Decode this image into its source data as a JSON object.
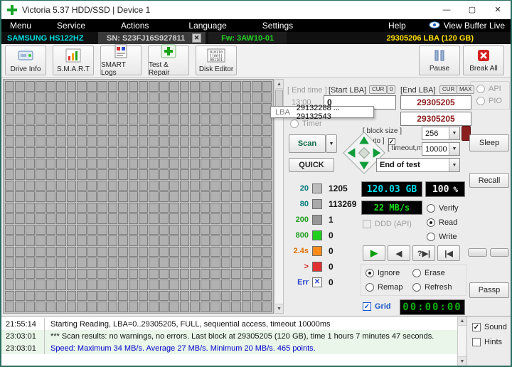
{
  "window": {
    "title": "Victoria 5.37 HDD/SSD | Device 1",
    "minimize_icon": "—",
    "maximize_icon": "▢",
    "close_icon": "✕"
  },
  "icons": {
    "dropdown": "▼",
    "arrow_up": "▲",
    "arrow_down": "▼"
  },
  "menu": {
    "items": [
      "Menu",
      "Service",
      "Actions",
      "Language",
      "Settings",
      "Help"
    ],
    "view_buffer_label": "View Buffer Live"
  },
  "infobar": {
    "model": "SAMSUNG HS122HZ",
    "serial": "SN: S23FJ16S927811",
    "close_icon": "✕",
    "firmware": "Fw: 3AW10-01",
    "capacity": "29305206 LBA (120 GB)"
  },
  "toolbar": {
    "buttons": [
      {
        "label": "Drive Info"
      },
      {
        "label": "S.M.A.R.T"
      },
      {
        "label": "SMART Logs"
      },
      {
        "label": "Test & Repair"
      },
      {
        "label": "Disk Editor"
      }
    ],
    "pause_label": "Pause",
    "break_all_label": "Break All"
  },
  "panel": {
    "api_label": "API",
    "pio_label": "PIO",
    "end_time_label": "[ End time ]",
    "end_time_value": "13:00",
    "start_lba_label": "[Start LBA]",
    "cur_label": "CUR",
    "cur_value": "0",
    "start_lba_value": "0",
    "end_lba_label": "[End LBA]",
    "max_label": "MAX",
    "end_lba_value": "29305205",
    "end_lba_value_2": "29305205",
    "tooltip": {
      "label": "LBA",
      "range": "29132288 ... 29132543"
    },
    "timer_radio_label": "Timer",
    "scan_label": "Scan",
    "quick_label": "QUICK",
    "block_size_label": "[ block size ]",
    "auto_label": "[ auto ]",
    "auto_checked": true,
    "block_size_value": "256",
    "timeout_label": "[ timeout,ms ]",
    "timeout_value": "10000",
    "end_of_test_value": "End of test",
    "sleep_label": "Sleep",
    "recall_label": "Recall",
    "passp_label": "Passp",
    "legend": [
      {
        "label": "20",
        "count": "1205",
        "block_color": "#bcbcbc",
        "label_color": "#00777a"
      },
      {
        "label": "80",
        "count": "113269",
        "block_color": "#a9a9a9",
        "label_color": "#00777a"
      },
      {
        "label": "200",
        "count": "1",
        "block_color": "#979797",
        "label_color": "#1f9e20"
      },
      {
        "label": "800",
        "count": "0",
        "block_color": "#1fd01f",
        "label_color": "#1f9e20"
      },
      {
        "label": "2.4s",
        "count": "0",
        "block_color": "#ff8c1a",
        "label_color": "#e07000"
      },
      {
        "label": ">",
        "count": "0",
        "block_color": "#e03030",
        "label_color": "#d02020"
      },
      {
        "label": "Err",
        "count": "0",
        "block_color": "#ffffff",
        "label_color": "#2741cc",
        "symbol": "✕"
      }
    ],
    "size_display": "120.03 GB",
    "percent_value": "100",
    "percent_unit": "%",
    "speed_display": "22 MB/s",
    "ddd_label": "DDD (API)",
    "ddd_checked": false,
    "rw_options": [
      {
        "label": "Verify",
        "selected": false
      },
      {
        "label": "Read",
        "selected": true
      },
      {
        "label": "Write",
        "selected": false
      }
    ],
    "playback": [
      {
        "name": "play",
        "icon": "▶"
      },
      {
        "name": "step-back",
        "icon": "◀"
      },
      {
        "name": "seek-error",
        "icon": "?▶|"
      },
      {
        "name": "seek-end",
        "icon": "|◀"
      }
    ],
    "action_options": [
      {
        "label": "Ignore",
        "selected": true
      },
      {
        "label": "Erase",
        "selected": false
      },
      {
        "label": "Remap",
        "selected": false
      },
      {
        "label": "Refresh",
        "selected": false
      }
    ],
    "grid_label": "Grid",
    "grid_checked": true,
    "timer_display": "00:00:00"
  },
  "log": {
    "rows": [
      {
        "time": "21:55:14",
        "text": "Starting Reading, LBA=0..29305205, FULL, sequential access, timeout 10000ms"
      },
      {
        "time": "23:03:01",
        "text": "*** Scan results: no warnings, no errors. Last block at 29305205 (120 GB), time 1 hours 7 minutes 47 seconds."
      },
      {
        "time": "23:03:01",
        "text": "Speed: Maximum 34 MB/s. Average 27 MB/s. Minimum 20 MB/s. 465 points."
      }
    ],
    "sound_label": "Sound",
    "sound_checked": true,
    "hints_label": "Hints",
    "hints_checked": false
  }
}
